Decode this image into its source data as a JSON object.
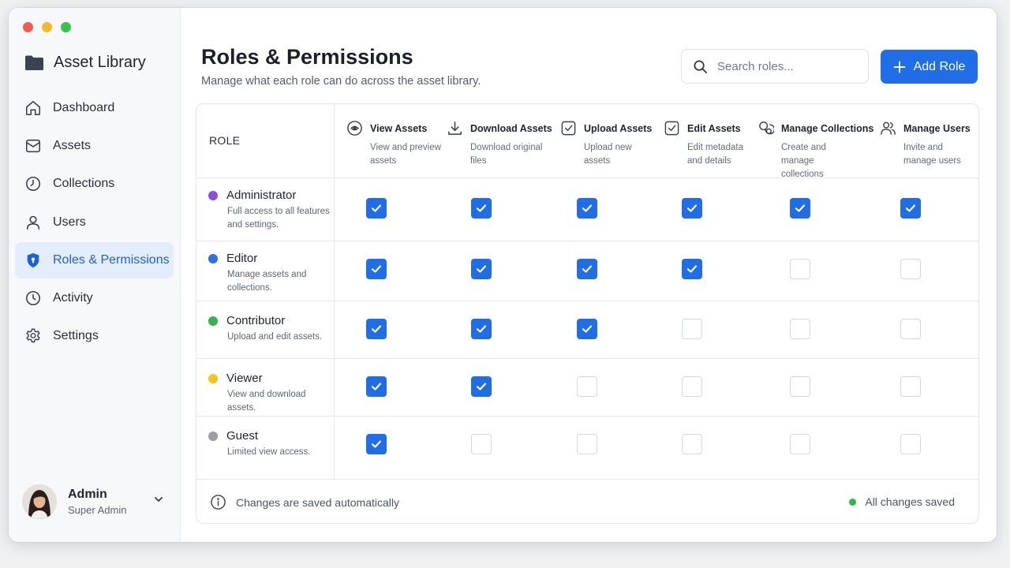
{
  "app": {
    "title": "Asset Library"
  },
  "sidebar": {
    "items": [
      {
        "label": "Dashboard",
        "icon": "home-icon",
        "active": false
      },
      {
        "label": "Assets",
        "icon": "mail-icon",
        "active": false
      },
      {
        "label": "Collections",
        "icon": "clock-icon",
        "active": false
      },
      {
        "label": "Users",
        "icon": "user-icon",
        "active": false
      },
      {
        "label": "Roles & Permissions",
        "icon": "shield-icon",
        "active": true
      },
      {
        "label": "Activity",
        "icon": "history-icon",
        "active": false
      },
      {
        "label": "Settings",
        "icon": "gear-icon",
        "active": false
      }
    ],
    "user": {
      "name": "Admin",
      "role": "Super Admin"
    }
  },
  "header": {
    "title": "Roles & Permissions",
    "subtitle": "Manage what each role can do across the asset library.",
    "search_placeholder": "Search roles...",
    "add_label": "Add Role"
  },
  "table": {
    "role_header": "ROLE",
    "permissions": [
      {
        "title": "View Assets",
        "desc": "View and preview assets",
        "icon": "eye-icon"
      },
      {
        "title": "Download Assets",
        "desc": "Download original files",
        "icon": "download-icon"
      },
      {
        "title": "Upload Assets",
        "desc": "Upload new assets",
        "icon": "checkbox-icon"
      },
      {
        "title": "Edit Assets",
        "desc": "Edit metadata and details",
        "icon": "checkbox-icon"
      },
      {
        "title": "Manage Collections",
        "desc": "Create and manage collections",
        "icon": "collections-icon"
      },
      {
        "title": "Manage Users",
        "desc": "Invite and manage users",
        "icon": "users-icon"
      }
    ],
    "roles": [
      {
        "name": "Administrator",
        "desc": "Full access to all features and settings.",
        "color": "#8a4fdc",
        "perms": [
          true,
          true,
          true,
          true,
          true,
          true
        ]
      },
      {
        "name": "Editor",
        "desc": "Manage assets and collections.",
        "color": "#2f6fe4",
        "perms": [
          true,
          true,
          true,
          true,
          false,
          false
        ]
      },
      {
        "name": "Contributor",
        "desc": "Upload and edit assets.",
        "color": "#35b34f",
        "perms": [
          true,
          true,
          true,
          false,
          false,
          false
        ]
      },
      {
        "name": "Viewer",
        "desc": "View and download assets.",
        "color": "#f5c518",
        "perms": [
          true,
          true,
          false,
          false,
          false,
          false
        ]
      },
      {
        "name": "Guest",
        "desc": "Limited view access.",
        "color": "#9a9da3",
        "perms": [
          true,
          false,
          false,
          false,
          false,
          false
        ]
      }
    ]
  },
  "footer": {
    "note": "Changes are saved automatically",
    "status": "All changes saved"
  },
  "colors": {
    "accent": "#1f6ee8",
    "active_bg": "#e3edfc",
    "saved": "#2fb84a"
  }
}
